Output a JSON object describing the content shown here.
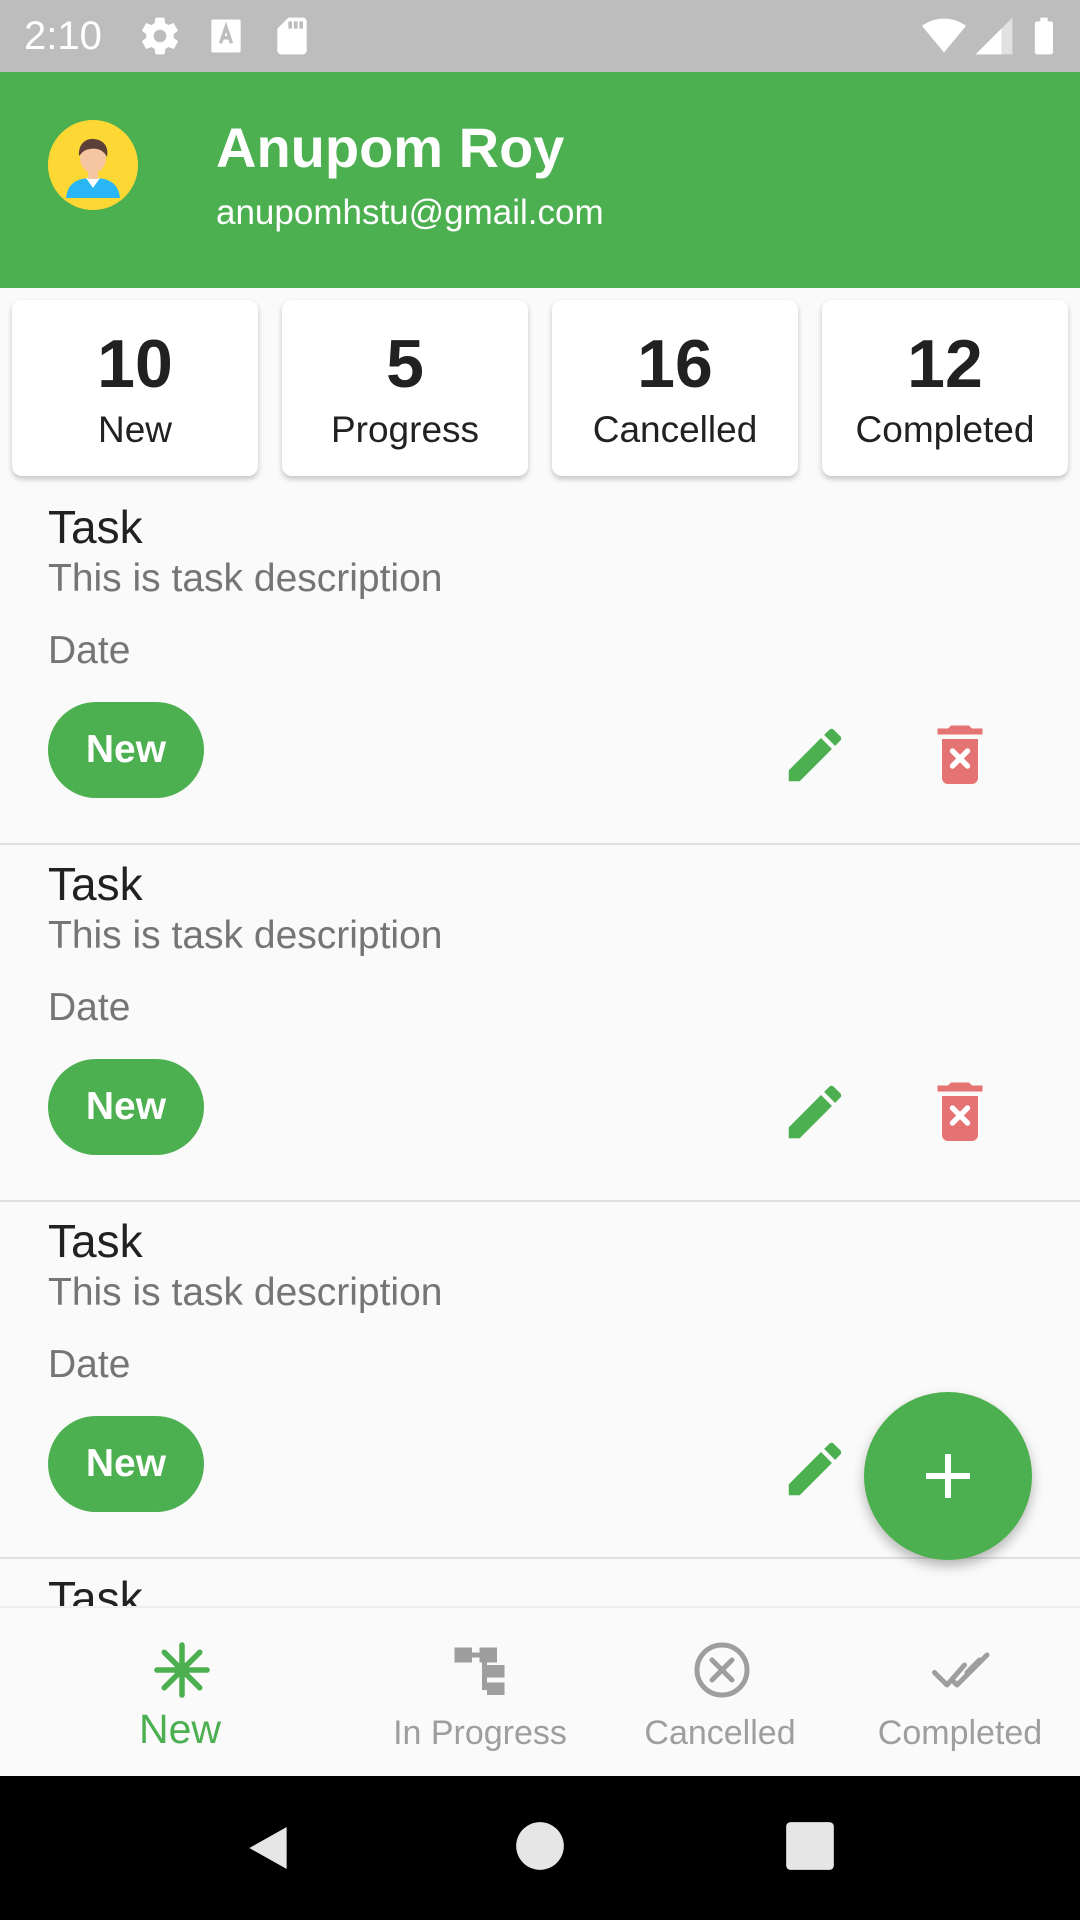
{
  "status_bar": {
    "time": "2:10"
  },
  "header": {
    "user_name": "Anupom Roy",
    "user_email": "anupomhstu@gmail.com"
  },
  "summary": [
    {
      "count": "10",
      "label": "New"
    },
    {
      "count": "5",
      "label": "Progress"
    },
    {
      "count": "16",
      "label": "Cancelled"
    },
    {
      "count": "12",
      "label": "Completed"
    }
  ],
  "tasks": [
    {
      "title": "Task",
      "description": "This is task description",
      "date": "Date",
      "status": "New"
    },
    {
      "title": "Task",
      "description": "This is task description",
      "date": "Date",
      "status": "New"
    },
    {
      "title": "Task",
      "description": "This is task description",
      "date": "Date",
      "status": "New"
    },
    {
      "title": "Task",
      "description": "",
      "date": "",
      "status": ""
    }
  ],
  "bottom_nav": {
    "items": [
      {
        "label": "New",
        "icon": "asterisk-icon",
        "active": true
      },
      {
        "label": "In Progress",
        "icon": "flow-icon",
        "active": false
      },
      {
        "label": "Cancelled",
        "icon": "cancel-circle-icon",
        "active": false
      },
      {
        "label": "Completed",
        "icon": "done-all-icon",
        "active": false
      }
    ]
  },
  "colors": {
    "primary": "#4caf50",
    "delete": "#e57373",
    "status_bar": "#bdbdbd",
    "inactive": "#9e9e9e"
  }
}
